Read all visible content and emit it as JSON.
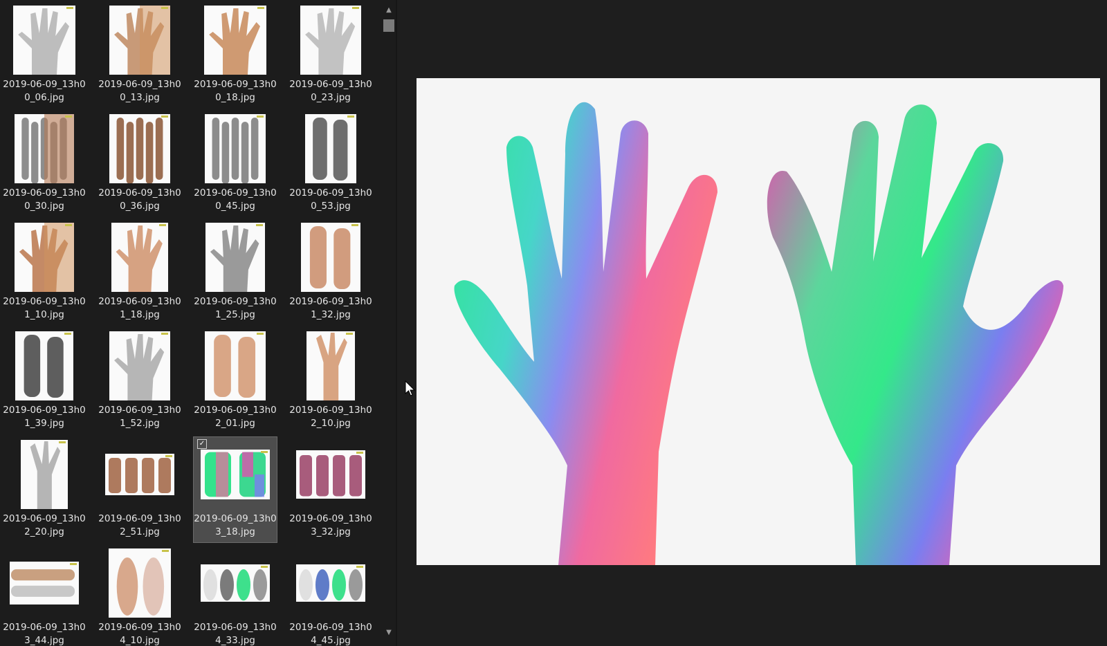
{
  "thumbnails": [
    {
      "name": "2019-06-09_13h0\n0_06.jpg",
      "tone": "#bdbdbd",
      "w": 90,
      "h": 100,
      "kind": "hand"
    },
    {
      "name": "2019-06-09_13h0\n0_13.jpg",
      "tone": "#c89a78",
      "w": 88,
      "h": 100,
      "kind": "hand-split"
    },
    {
      "name": "2019-06-09_13h0\n0_18.jpg",
      "tone": "#cf9a72",
      "w": 90,
      "h": 100,
      "kind": "hand"
    },
    {
      "name": "2019-06-09_13h0\n0_23.jpg",
      "tone": "#c2c2c2",
      "w": 88,
      "h": 100,
      "kind": "hand"
    },
    {
      "name": "2019-06-09_13h0\n0_30.jpg",
      "tone": "#8d8d8d",
      "w": 86,
      "h": 100,
      "kind": "fingers-split"
    },
    {
      "name": "2019-06-09_13h0\n0_36.jpg",
      "tone": "#9b6e52",
      "w": 88,
      "h": 100,
      "kind": "fingers"
    },
    {
      "name": "2019-06-09_13h0\n0_45.jpg",
      "tone": "#8c8c8c",
      "w": 88,
      "h": 100,
      "kind": "fingers"
    },
    {
      "name": "2019-06-09_13h0\n0_53.jpg",
      "tone": "#6e6e6e",
      "w": 74,
      "h": 100,
      "kind": "side"
    },
    {
      "name": "2019-06-09_13h0\n1_10.jpg",
      "tone": "#c48a66",
      "w": 86,
      "h": 100,
      "kind": "hand-split"
    },
    {
      "name": "2019-06-09_13h0\n1_18.jpg",
      "tone": "#d6a282",
      "w": 82,
      "h": 100,
      "kind": "hand"
    },
    {
      "name": "2019-06-09_13h0\n1_25.jpg",
      "tone": "#9a9a9a",
      "w": 86,
      "h": 100,
      "kind": "hand"
    },
    {
      "name": "2019-06-09_13h0\n1_32.jpg",
      "tone": "#d19c7e",
      "w": 86,
      "h": 100,
      "kind": "side"
    },
    {
      "name": "2019-06-09_13h0\n1_39.jpg",
      "tone": "#5e5e5e",
      "w": 84,
      "h": 100,
      "kind": "side"
    },
    {
      "name": "2019-06-09_13h0\n1_52.jpg",
      "tone": "#b6b6b6",
      "w": 88,
      "h": 100,
      "kind": "hand"
    },
    {
      "name": "2019-06-09_13h0\n2_01.jpg",
      "tone": "#d9a686",
      "w": 88,
      "h": 100,
      "kind": "side"
    },
    {
      "name": "2019-06-09_13h0\n2_10.jpg",
      "tone": "#d8a482",
      "w": 70,
      "h": 100,
      "kind": "arm"
    },
    {
      "name": "2019-06-09_13h0\n2_20.jpg",
      "tone": "#b5b5b5",
      "w": 68,
      "h": 100,
      "kind": "arm"
    },
    {
      "name": "2019-06-09_13h0\n2_51.jpg",
      "tone": "#ae7a5e",
      "w": 100,
      "h": 60,
      "kind": "row"
    },
    {
      "name": "2019-06-09_13h0\n3_18.jpg",
      "tone": "#3ee08c",
      "w": 100,
      "h": 72,
      "kind": "normal"
    },
    {
      "name": "2019-06-09_13h0\n3_32.jpg",
      "tone": "#a85c7c",
      "w": 100,
      "h": 70,
      "kind": "row"
    },
    {
      "name": "2019-06-09_13h0\n3_44.jpg",
      "tone": "#c9a080",
      "w": 100,
      "h": 62,
      "kind": "arm-h"
    },
    {
      "name": "2019-06-09_13h0\n4_10.jpg",
      "tone": "#d8a88c",
      "w": 90,
      "h": 100,
      "kind": "feet"
    },
    {
      "name": "2019-06-09_13h0\n4_33.jpg",
      "tone": "#7b7b7b",
      "w": 100,
      "h": 54,
      "kind": "feet-multi"
    },
    {
      "name": "2019-06-09_13h0\n4_45.jpg",
      "tone": "#5f7cc8",
      "w": 100,
      "h": 54,
      "kind": "feet-multi"
    }
  ],
  "selected_index": 18,
  "check_mark": "✓",
  "scroll_up_arrow": "▲",
  "scroll_down_arrow": "▼",
  "colors": {
    "panel_bg": "#1c1c1c",
    "selected_bg": "#4d4d4d",
    "text": "#e6e6e6",
    "preview_bg": "#f5f5f5"
  }
}
